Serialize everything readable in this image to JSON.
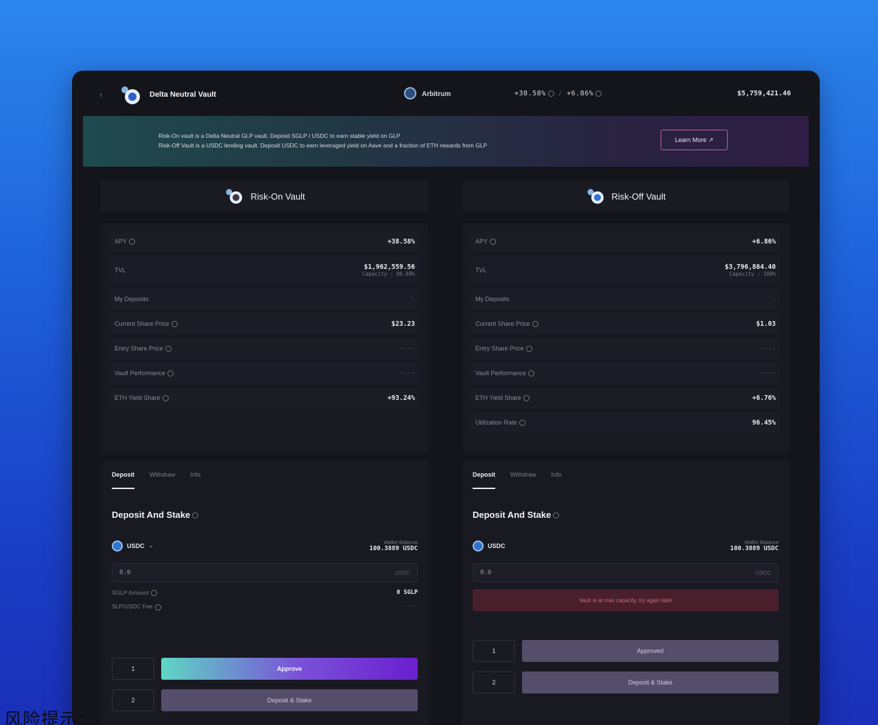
{
  "header": {
    "back_icon": "back-arrow-icon",
    "vault_title": "Delta Neutral Vault",
    "network": "Arbitrum",
    "apy_on": "+38.58%",
    "apy_off": "+6.86%",
    "tvl": "$5,759,421.46"
  },
  "banner": {
    "line1": "Risk-On vault is a Delta Neutral GLP vault. Deposit SGLP / USDC to earn stable yield on GLP",
    "line2": "Risk-Off Vault is a USDC lending vault. Deposit USDC to earn leveraged yield on Aave and a fraction of ETH rewards from GLP",
    "learn_more": "Learn More ↗"
  },
  "risk_on": {
    "title": "Risk-On Vault",
    "stats": [
      {
        "label": "APY",
        "value": "+38.58%"
      },
      {
        "label": "TVL",
        "value": "$1,962,559.56",
        "sub": "Capacity : 96.69%"
      },
      {
        "label": "My Deposits",
        "value": "-"
      },
      {
        "label": "Current Share Price",
        "value": "$23.23"
      },
      {
        "label": "Entry Share Price",
        "value": "----"
      },
      {
        "label": "Vault Performance",
        "value": "----"
      },
      {
        "label": "ETH Yield Share",
        "value": "+93.24%"
      }
    ],
    "tabs": [
      "Deposit",
      "Withdraw",
      "Info"
    ],
    "section_title": "Deposit And Stake",
    "token": "USDC",
    "balance_label": "Wallet Balance",
    "balance": "100.3889 USDC",
    "amount": "0.0",
    "amount_unit": "USDC",
    "kv": [
      {
        "label": "SGLP Amount",
        "value": "0 SGLP"
      },
      {
        "label": "SLP/USDC Fee",
        "value": "----"
      }
    ],
    "steps": [
      {
        "num": "1",
        "label": "Approve"
      },
      {
        "num": "2",
        "label": "Deposit & Stake"
      }
    ]
  },
  "risk_off": {
    "title": "Risk-Off Vault",
    "stats": [
      {
        "label": "APY",
        "value": "+6.86%"
      },
      {
        "label": "TVL",
        "value": "$3,796,864.40",
        "sub": "Capacity : 100%"
      },
      {
        "label": "My Deposits",
        "value": "-"
      },
      {
        "label": "Current Share Price",
        "value": "$1.03"
      },
      {
        "label": "Entry Share Price",
        "value": "----"
      },
      {
        "label": "Vault Performance",
        "value": "----"
      },
      {
        "label": "ETH Yield Share",
        "value": "+6.76%"
      },
      {
        "label": "Utilization Rate",
        "value": "96.45%"
      }
    ],
    "tabs": [
      "Deposit",
      "Withdraw",
      "Info"
    ],
    "section_title": "Deposit And Stake",
    "token": "USDC",
    "balance_label": "Wallet Balance",
    "balance": "100.3889 USDC",
    "amount": "0.0",
    "amount_unit": "USDC",
    "warning": "Vault is at max capacity, try again later",
    "steps": [
      {
        "num": "1",
        "label": "Approved"
      },
      {
        "num": "2",
        "label": "Deposit & Stake"
      }
    ]
  },
  "footer": {
    "text": "风险提示："
  },
  "colors": {
    "background_top": "#2b86ec",
    "background_bottom": "#1b2fb8",
    "panel": "#191922",
    "accent_gradient_start": "#5ed6c4",
    "accent_gradient_end": "#6a1fd0",
    "warning_bg": "#4a1f2c"
  }
}
